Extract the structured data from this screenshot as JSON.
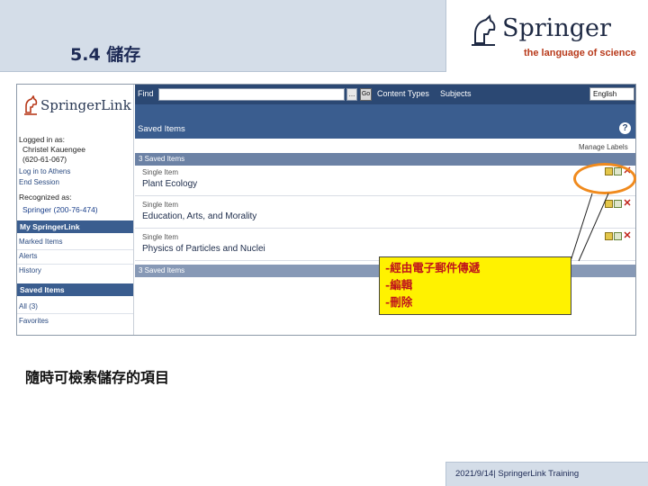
{
  "slide": {
    "title": "5.4 儲存",
    "brand_name": "Springer",
    "brand_tagline": "the language of science",
    "caption": "隨時可檢索儲存的項目",
    "footer": "2021/9/14| SpringerLink Training"
  },
  "sidebar": {
    "logo_text": "SpringerLink",
    "logged_in_label": "Logged in as:",
    "user_name": "Christel Kauengee",
    "user_id": "(620-61-067)",
    "log_in_link": "Log in to Athens",
    "end_session_link": "End Session",
    "recognized_label": "Recognized as:",
    "org_name": "Springer (200-76-474)",
    "my_springerlink_heading": "My SpringerLink",
    "my_links": [
      "Marked Items",
      "Alerts",
      "History"
    ],
    "saved_items_heading": "Saved Items",
    "saved_links": [
      "All (3)",
      "Favorites"
    ]
  },
  "topbar": {
    "find_label": "Find",
    "search_value": "",
    "dots_label": "...",
    "go_label": "Go",
    "nav_links": [
      "Content Types",
      "Subjects"
    ],
    "language": "English"
  },
  "main": {
    "page_heading": "Saved Items",
    "help_icon": "?",
    "manage_labels": "Manage Labels",
    "header_bar": "3 Saved Items",
    "footer_bar": "3 Saved Items",
    "items": [
      {
        "type": "Single Item",
        "title": "Plant Ecology"
      },
      {
        "type": "Single Item",
        "title": "Education, Arts, and Morality"
      },
      {
        "type": "Single Item",
        "title": "Physics of Particles and Nuclei"
      }
    ],
    "action_icons": [
      "email-icon",
      "edit-icon",
      "delete-icon"
    ]
  },
  "callout": {
    "lines": [
      "-經由電子郵件傳遞",
      "-編輯",
      "-刪除"
    ],
    "oval_color": "#f08a1d",
    "background_color": "#fff200",
    "text_color": "#c0151b"
  },
  "colors": {
    "header_band": "#d4dde8",
    "nav_bar": "#2b4873",
    "section_blue": "#3a5d8f",
    "brand_red": "#b83a1b"
  }
}
